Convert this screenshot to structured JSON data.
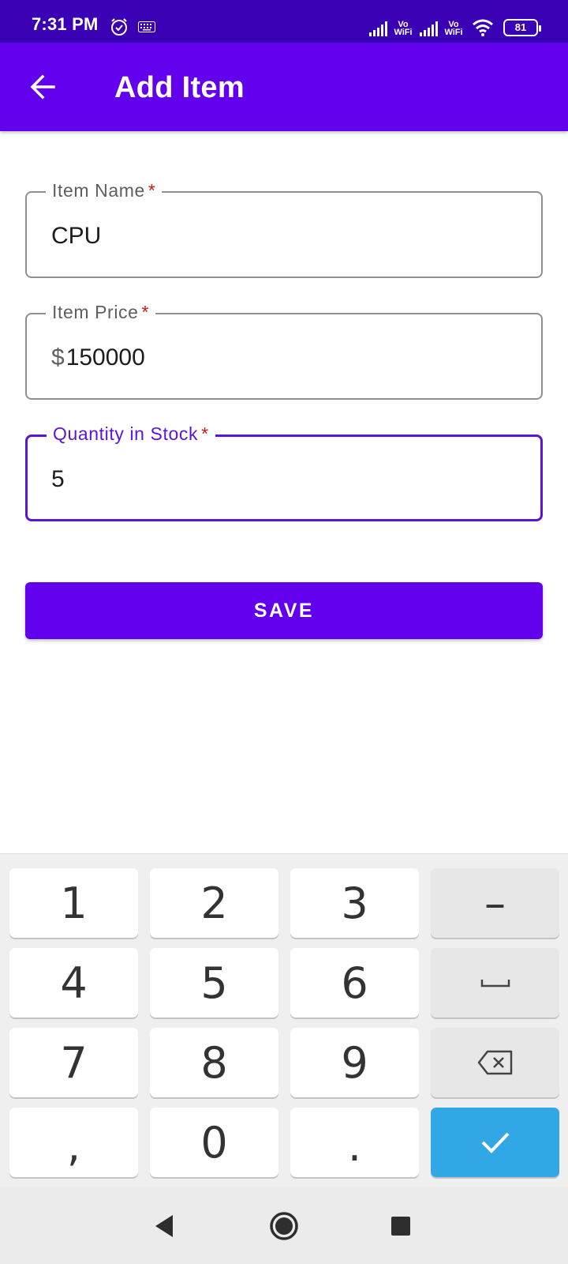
{
  "status_bar": {
    "time": "7:31 PM",
    "vowifi_1": {
      "top": "Vo",
      "bottom": "WiFi"
    },
    "vowifi_2": {
      "top": "Vo",
      "bottom": "WiFi"
    },
    "battery": "81"
  },
  "app_bar": {
    "title": "Add Item",
    "back_icon": "arrow-left-icon"
  },
  "form": {
    "item_name": {
      "label": "Item Name",
      "required_mark": "*",
      "value": "CPU"
    },
    "item_price": {
      "label": "Item Price",
      "required_mark": "*",
      "prefix": "$",
      "value": "150000"
    },
    "quantity": {
      "label": "Quantity in Stock",
      "required_mark": "*",
      "value": "5"
    },
    "save_label": "SAVE"
  },
  "keyboard": {
    "keys": {
      "k1": "1",
      "k2": "2",
      "k3": "3",
      "minus": "–",
      "k4": "4",
      "k5": "5",
      "k6": "6",
      "k7": "7",
      "k8": "8",
      "k9": "9",
      "comma": ",",
      "k0": "0",
      "period": "."
    },
    "icons": {
      "space": "space-bar-icon",
      "backspace": "backspace-icon",
      "enter": "check-icon"
    }
  },
  "nav_bar": {
    "icons": [
      "back-triangle-icon",
      "home-circle-icon",
      "recents-square-icon"
    ]
  },
  "colors": {
    "status_bar": "#3a00b3",
    "primary": "#6200ee",
    "focused_outline": "#5c14d6",
    "required": "#d01818",
    "enter_key": "#32a7e6"
  }
}
